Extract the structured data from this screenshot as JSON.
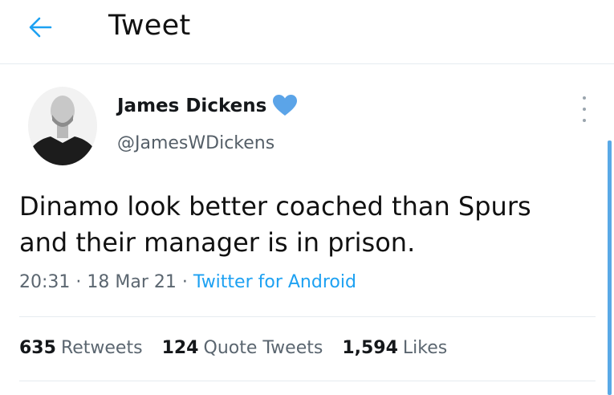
{
  "header": {
    "back_icon": "arrow-left-icon",
    "title": "Tweet"
  },
  "tweet": {
    "author_name": "James Dickens",
    "badge_icon": "heart-icon",
    "handle": "@JamesWDickens",
    "text_line1": "Dinamo look better coached than Spurs",
    "text_line2": "and their manager is in prison.",
    "time": "20:31",
    "date": "18 Mar 21",
    "separator": "·",
    "source": "Twitter for Android",
    "more_icon": "vertical-dots-icon"
  },
  "stats": {
    "retweets_count": "635",
    "retweets_label": "Retweets",
    "quote_count": "124",
    "quote_label": "Quote Tweets",
    "likes_count": "1,594",
    "likes_label": "Likes"
  },
  "colors": {
    "accent": "#1da1f2",
    "badge": "#5ba4e8",
    "divider": "#e6ecf0",
    "secondary_text": "#5b6670"
  }
}
